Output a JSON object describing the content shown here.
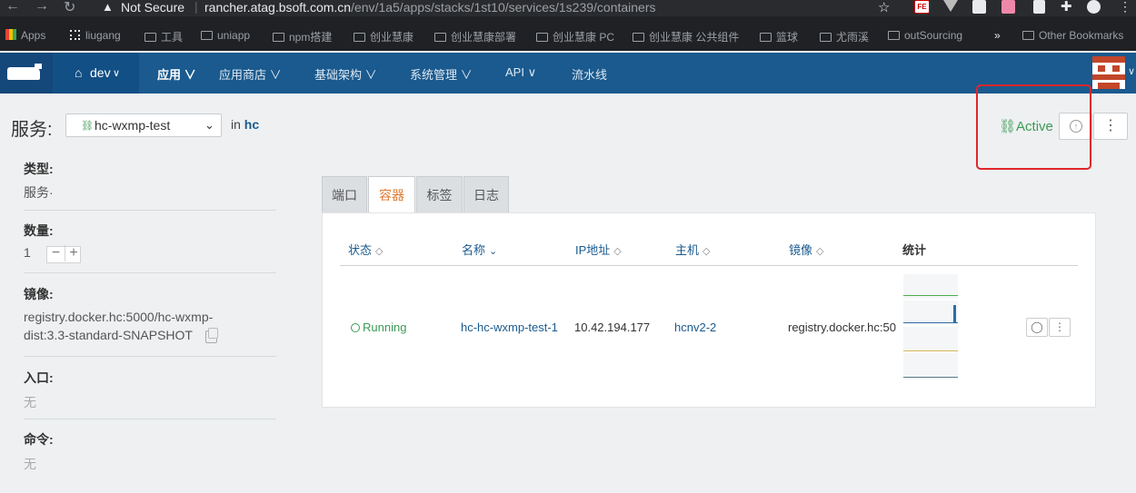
{
  "browser": {
    "security_label": "Not Secure",
    "url_host": "rancher.atag.bsoft.com.cn",
    "url_path": "/env/1a5/apps/stacks/1st10/services/1s239/containers",
    "bookmarks": [
      "Apps",
      "liugang",
      "工具",
      "uniapp",
      "npm搭建",
      "创业慧康",
      "创业慧康部署",
      "创业慧康 PC",
      "创业慧康 公共组件",
      "篮球",
      "尤雨溪",
      "outSourcing",
      "Other Bookmarks"
    ],
    "more_bookmarks": "»",
    "ext_fe": "FE"
  },
  "nav": {
    "env": "dev",
    "items": [
      "应用",
      "应用商店",
      "基础架构",
      "系统管理",
      "API",
      "流水线"
    ]
  },
  "service": {
    "title": "服务:",
    "name": "hc-wxmp-test",
    "in_label": "in",
    "stack": "hc",
    "state": "Active"
  },
  "details": {
    "type_label": "类型:",
    "type_value": "服务·",
    "scale_label": "数量:",
    "scale_value": "1",
    "image_label": "镜像:",
    "image_line1": "registry.docker.hc:5000/hc-wxmp-",
    "image_line2": "dist:3.3-standard-SNAPSHOT",
    "entry_label": "入口:",
    "entry_value": "无",
    "command_label": "命令:",
    "command_value": "无"
  },
  "tabs": [
    "端口",
    "容器",
    "标签",
    "日志"
  ],
  "table": {
    "headers": [
      "状态",
      "名称",
      "IP地址",
      "主机",
      "镜像",
      "统计"
    ],
    "rows": [
      {
        "state": "Running",
        "name": "hc-hc-wxmp-test-1",
        "ip": "10.42.194.177",
        "host": "hcnv2-2",
        "image": "registry.docker.hc:50"
      }
    ]
  },
  "colors": {
    "nav_bg": "#1a5a8e",
    "active_green": "#3d9b57",
    "tab_active": "#e07a30",
    "highlight_red": "#e0262a"
  }
}
